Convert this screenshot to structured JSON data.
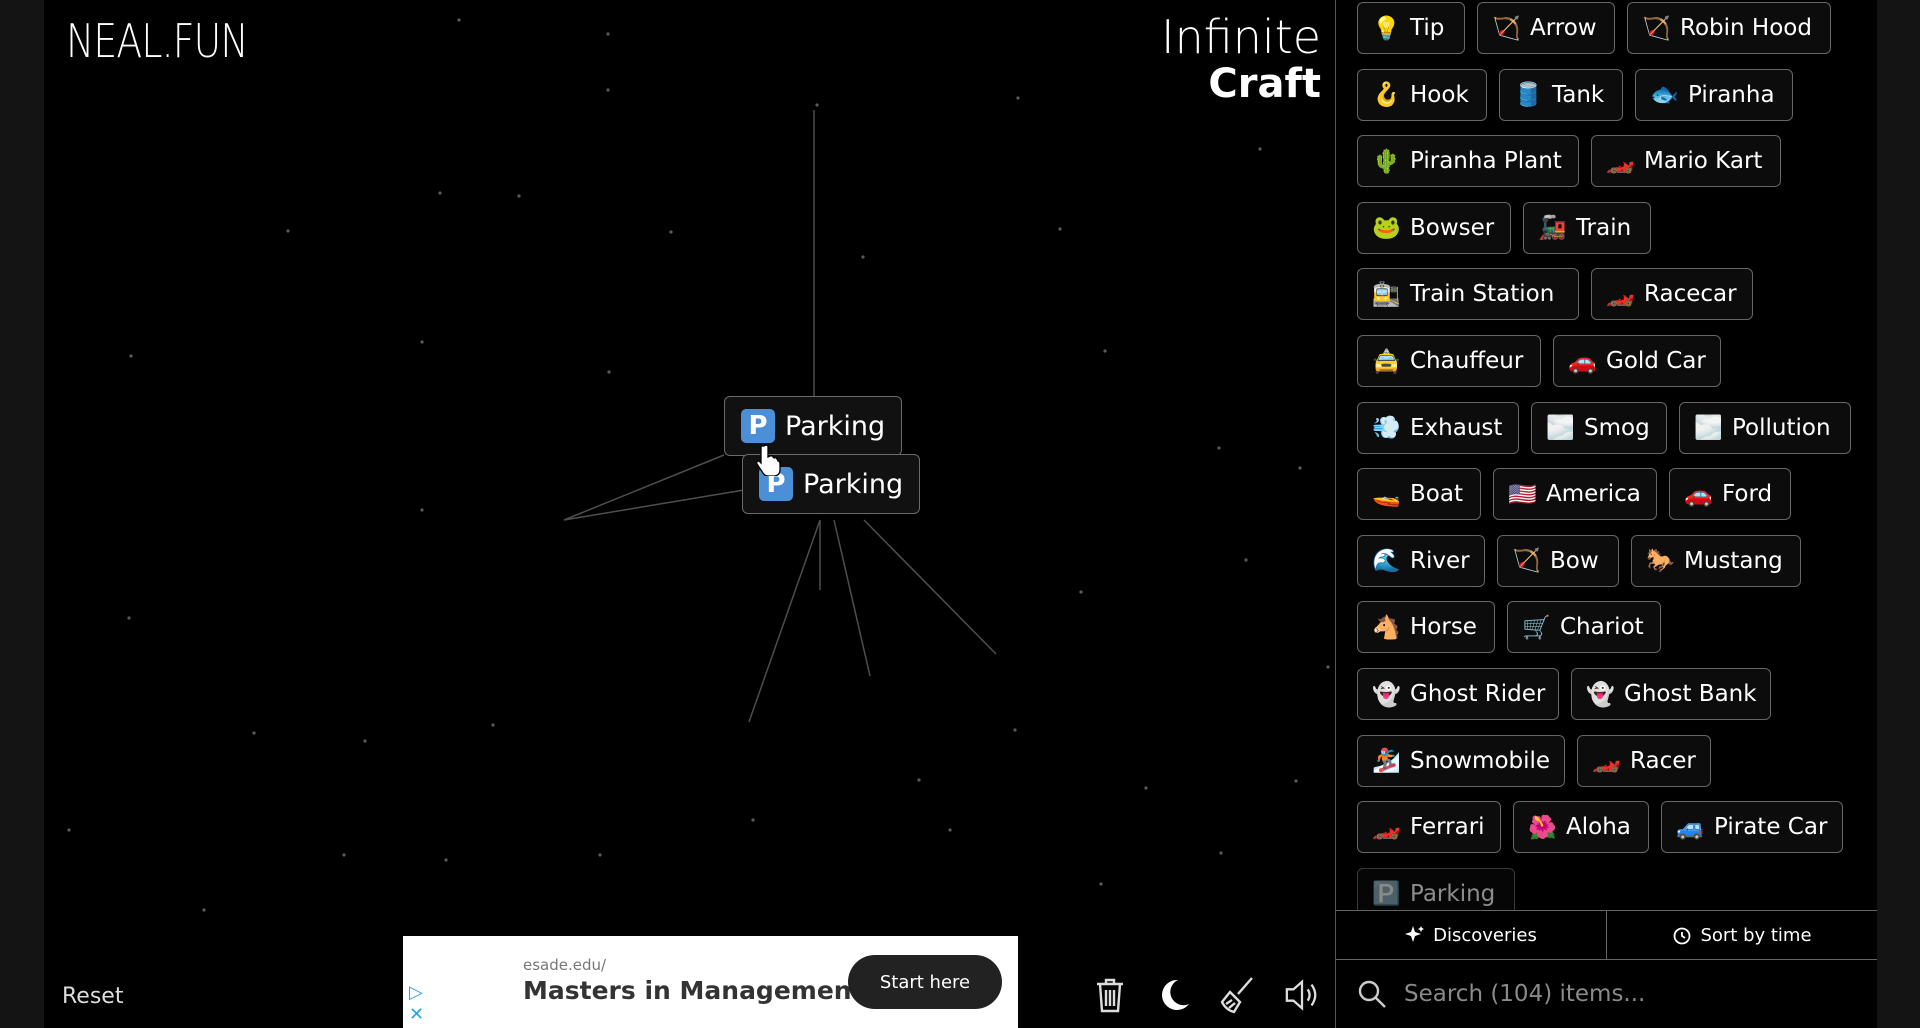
{
  "header": {
    "logo": "NEAL.FUN",
    "brand_line1": "Infinite",
    "brand_line2": "Craft"
  },
  "canvas_items": [
    {
      "icon": "P",
      "label": "Parking"
    },
    {
      "icon": "P",
      "label": "Parking"
    }
  ],
  "footer": {
    "reset_label": "Reset"
  },
  "ad": {
    "domain": "esade.edu/",
    "title": "Masters in Management",
    "cta": "Start here"
  },
  "tools": [
    "trash-icon",
    "moon-icon",
    "broom-icon",
    "speaker-icon"
  ],
  "sidebar": {
    "items": [
      {
        "emoji": "💡",
        "label": "Tip"
      },
      {
        "emoji": "🏹",
        "label": "Arrow"
      },
      {
        "emoji": "🏹",
        "label": "Robin Hood"
      },
      {
        "emoji": "🪝",
        "label": "Hook"
      },
      {
        "emoji": "🛢️",
        "label": "Tank"
      },
      {
        "emoji": "🐟",
        "label": "Piranha"
      },
      {
        "emoji": "🌵",
        "label": "Piranha Plant"
      },
      {
        "emoji": "🏎️",
        "label": "Mario Kart"
      },
      {
        "emoji": "🐸",
        "label": "Bowser"
      },
      {
        "emoji": "🚂",
        "label": "Train"
      },
      {
        "emoji": "🚉",
        "label": "Train Station"
      },
      {
        "emoji": "🏎️",
        "label": "Racecar"
      },
      {
        "emoji": "🚖",
        "label": "Chauffeur"
      },
      {
        "emoji": "🚗",
        "label": "Gold Car"
      },
      {
        "emoji": "💨",
        "label": "Exhaust"
      },
      {
        "emoji": "🌫️",
        "label": "Smog"
      },
      {
        "emoji": "🌫️",
        "label": "Pollution"
      },
      {
        "emoji": "🚤",
        "label": "Boat"
      },
      {
        "emoji": "🇺🇸",
        "label": "America"
      },
      {
        "emoji": "🚗",
        "label": "Ford"
      },
      {
        "emoji": "🌊",
        "label": "River"
      },
      {
        "emoji": "🏹",
        "label": "Bow"
      },
      {
        "emoji": "🐎",
        "label": "Mustang"
      },
      {
        "emoji": "🐴",
        "label": "Horse"
      },
      {
        "emoji": "🛒",
        "label": "Chariot"
      },
      {
        "emoji": "👻",
        "label": "Ghost Rider"
      },
      {
        "emoji": "👻",
        "label": "Ghost Bank"
      },
      {
        "emoji": "🏂",
        "label": "Snowmobile"
      },
      {
        "emoji": "🏎️",
        "label": "Racer"
      },
      {
        "emoji": "🏎️",
        "label": "Ferrari"
      },
      {
        "emoji": "🌺",
        "label": "Aloha"
      },
      {
        "emoji": "🚙",
        "label": "Pirate Car"
      },
      {
        "emoji": "🅿️",
        "label": "Parking"
      }
    ],
    "tab_discoveries": "Discoveries",
    "tab_sort": "Sort by time",
    "search_placeholder": "Search (104) items..."
  }
}
